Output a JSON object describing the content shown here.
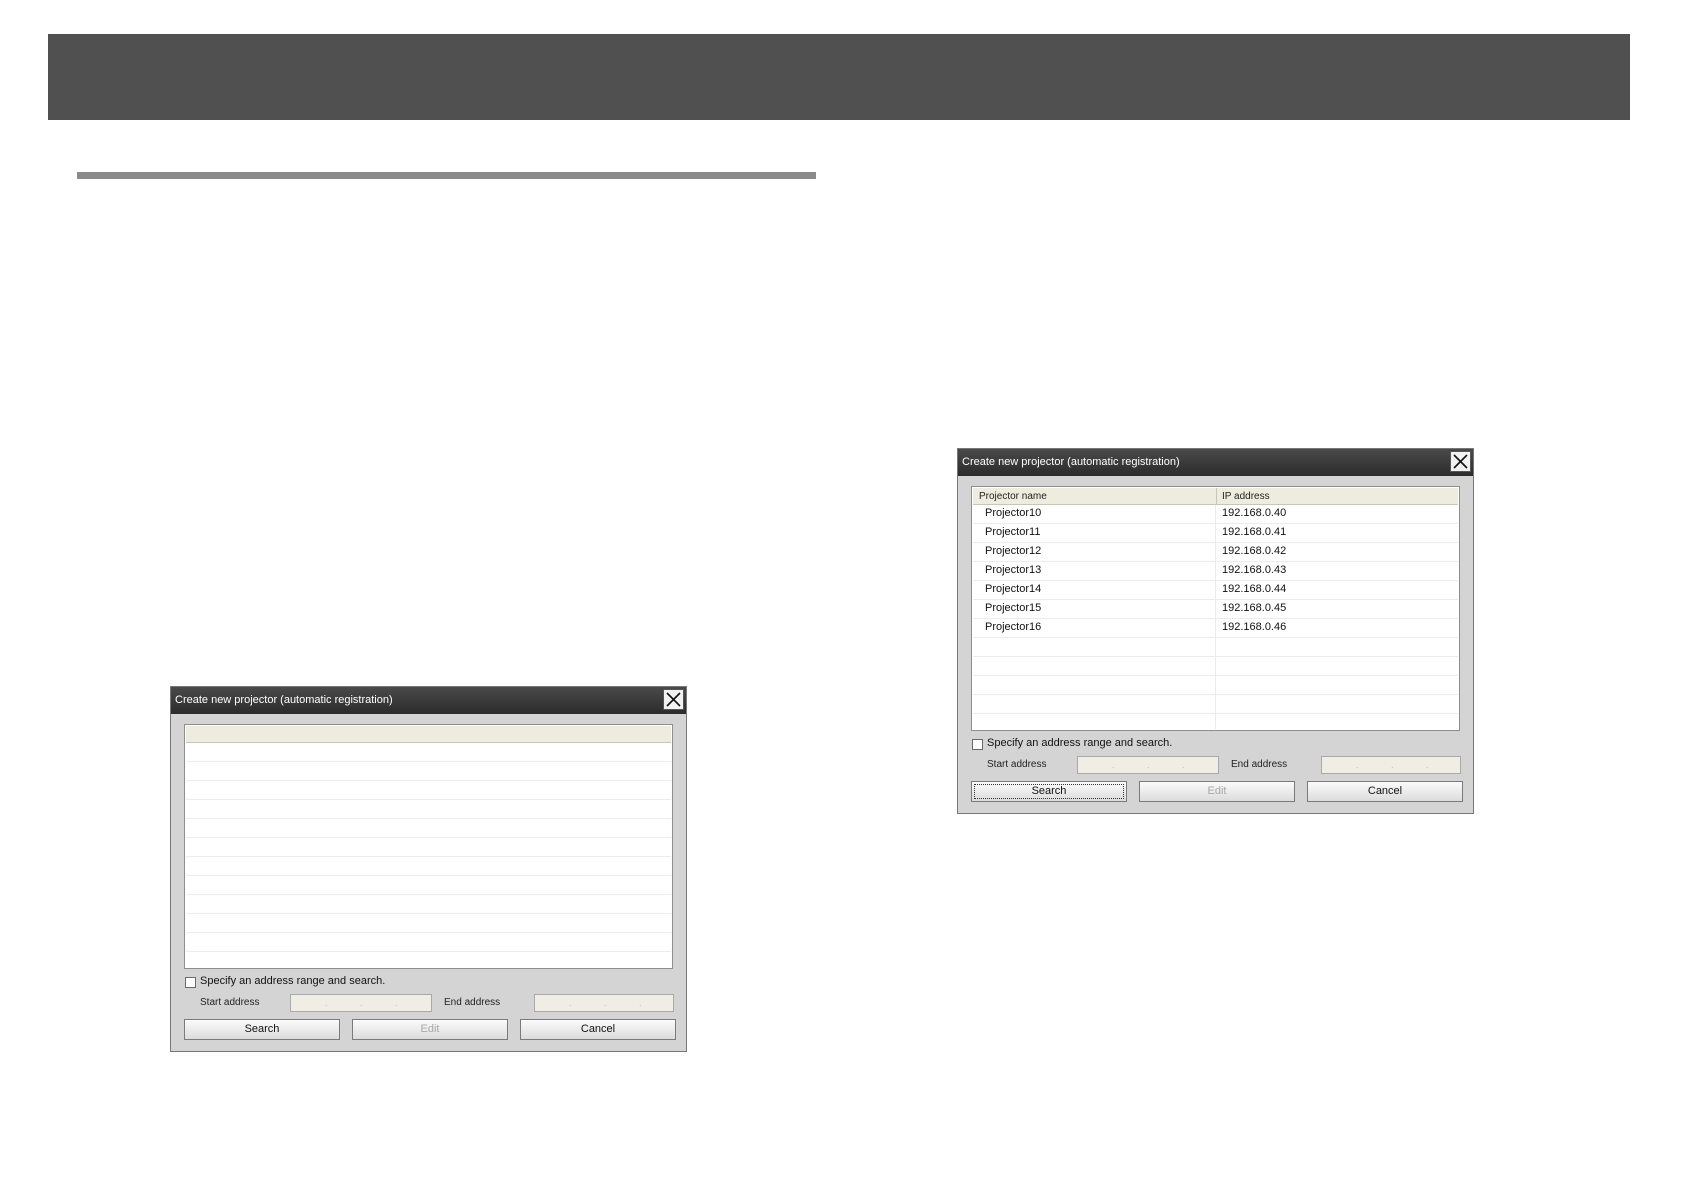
{
  "dialog_empty": {
    "title": "Create new projector (automatic registration)",
    "option_label": "Specify an address range and search.",
    "start_label": "Start address",
    "end_label": "End address",
    "buttons": {
      "search": "Search",
      "edit": "Edit",
      "cancel": "Cancel"
    }
  },
  "dialog_results": {
    "title": "Create new projector (automatic registration)",
    "columns": [
      "Projector name",
      "IP address"
    ],
    "rows": [
      [
        "Projector10",
        "192.168.0.40"
      ],
      [
        "Projector11",
        "192.168.0.41"
      ],
      [
        "Projector12",
        "192.168.0.42"
      ],
      [
        "Projector13",
        "192.168.0.43"
      ],
      [
        "Projector14",
        "192.168.0.44"
      ],
      [
        "Projector15",
        "192.168.0.45"
      ],
      [
        "Projector16",
        "192.168.0.46"
      ]
    ],
    "option_label": "Specify an address range and search.",
    "start_label": "Start address",
    "end_label": "End address",
    "buttons": {
      "search": "Search",
      "edit": "Edit",
      "cancel": "Cancel"
    }
  }
}
